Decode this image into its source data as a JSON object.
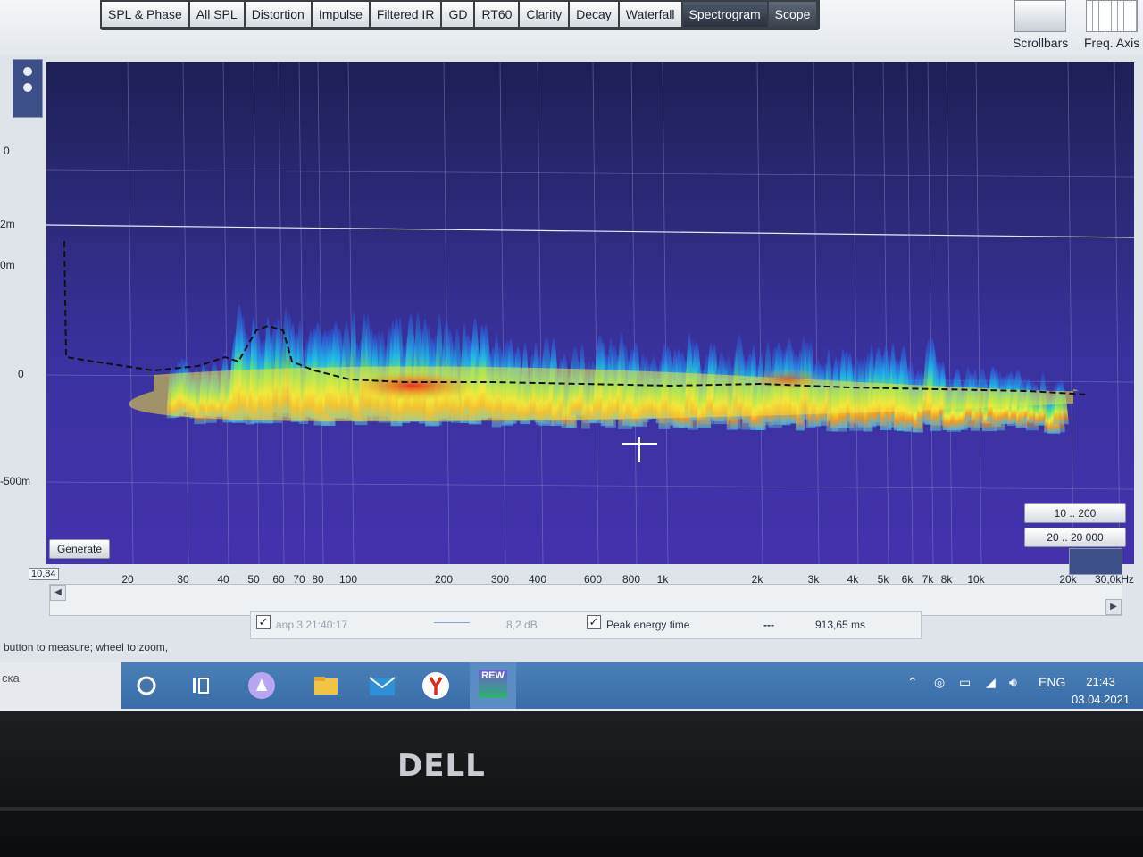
{
  "tabs": [
    "SPL & Phase",
    "All SPL",
    "Distortion",
    "Impulse",
    "Filtered IR",
    "GD",
    "RT60",
    "Clarity",
    "Decay",
    "Waterfall",
    "Spectrogram",
    "Scope"
  ],
  "active_tab": "Spectrogram",
  "toolbar_buttons": {
    "scrollbars": "Scrollbars",
    "freq_axis": "Freq. Axis"
  },
  "y_axis_labels": [
    "0",
    "2m",
    "0m",
    "0",
    "-500m"
  ],
  "x_axis": {
    "first": "10,84",
    "labels": [
      "20",
      "30",
      "40",
      "50",
      "60",
      "70",
      "80",
      "100",
      "200",
      "300",
      "400",
      "600",
      "800",
      "1k",
      "2k",
      "3k",
      "4k",
      "5k",
      "6k",
      "7k",
      "8k",
      "10k",
      "20k",
      "30,0kHz"
    ]
  },
  "buttons": {
    "generate": "Generate",
    "range_low": "10 .. 200",
    "range_full": "20 .. 20 000"
  },
  "legend": {
    "measurement": "anp 3 21:40:17",
    "measurement_db": "8,2 dB",
    "peak_label": "Peak energy time",
    "peak_style": "---",
    "peak_value": "913,65 ms"
  },
  "status_text": "button to measure; wheel to zoom,",
  "taskbar": {
    "search_stub": "ска",
    "rew_label": "REW",
    "lang": "ENG",
    "time": "21:43",
    "date": "03.04.2021"
  },
  "bezel_logo": "DELL",
  "colors": {
    "plot_top": "#1d1f55",
    "plot_bottom": "#4432ad",
    "active_tab": "#2a323d",
    "taskbar": "#3a6da7"
  }
}
